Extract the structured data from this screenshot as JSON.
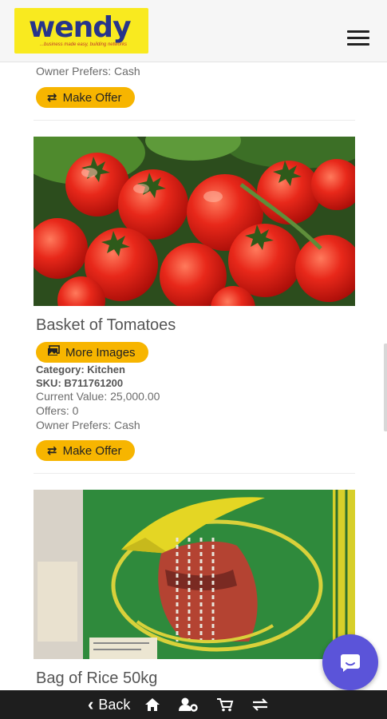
{
  "header": {
    "logo_text": "wendy",
    "logo_tagline": "...business made easy, building networks",
    "menu_icon": "hamburger-icon"
  },
  "listings": [
    {
      "owner_prefers": "Owner Prefers: Cash",
      "make_offer_label": "Make Offer"
    },
    {
      "title": "Basket of Tomatoes",
      "more_images_label": "More Images",
      "category": "Category: Kitchen",
      "sku": "SKU: B711761200",
      "current_value": "Current Value: 25,000.00",
      "offers": "Offers: 0",
      "owner_prefers": "Owner Prefers: Cash",
      "make_offer_label": "Make Offer"
    },
    {
      "title": "Bag of Rice 50kg"
    }
  ],
  "colors": {
    "accent": "#f7b500",
    "logo_bg": "#f9ea1f",
    "logo_text": "#27348b",
    "chat_fab": "#5b54d9",
    "bottom_bar": "#1e1e1e"
  },
  "bottom_nav": {
    "back_label": "Back",
    "icons": [
      "home-icon",
      "user-settings-icon",
      "cart-icon",
      "exchange-icon"
    ]
  },
  "chat": {
    "icon": "chat-bubble-icon"
  }
}
